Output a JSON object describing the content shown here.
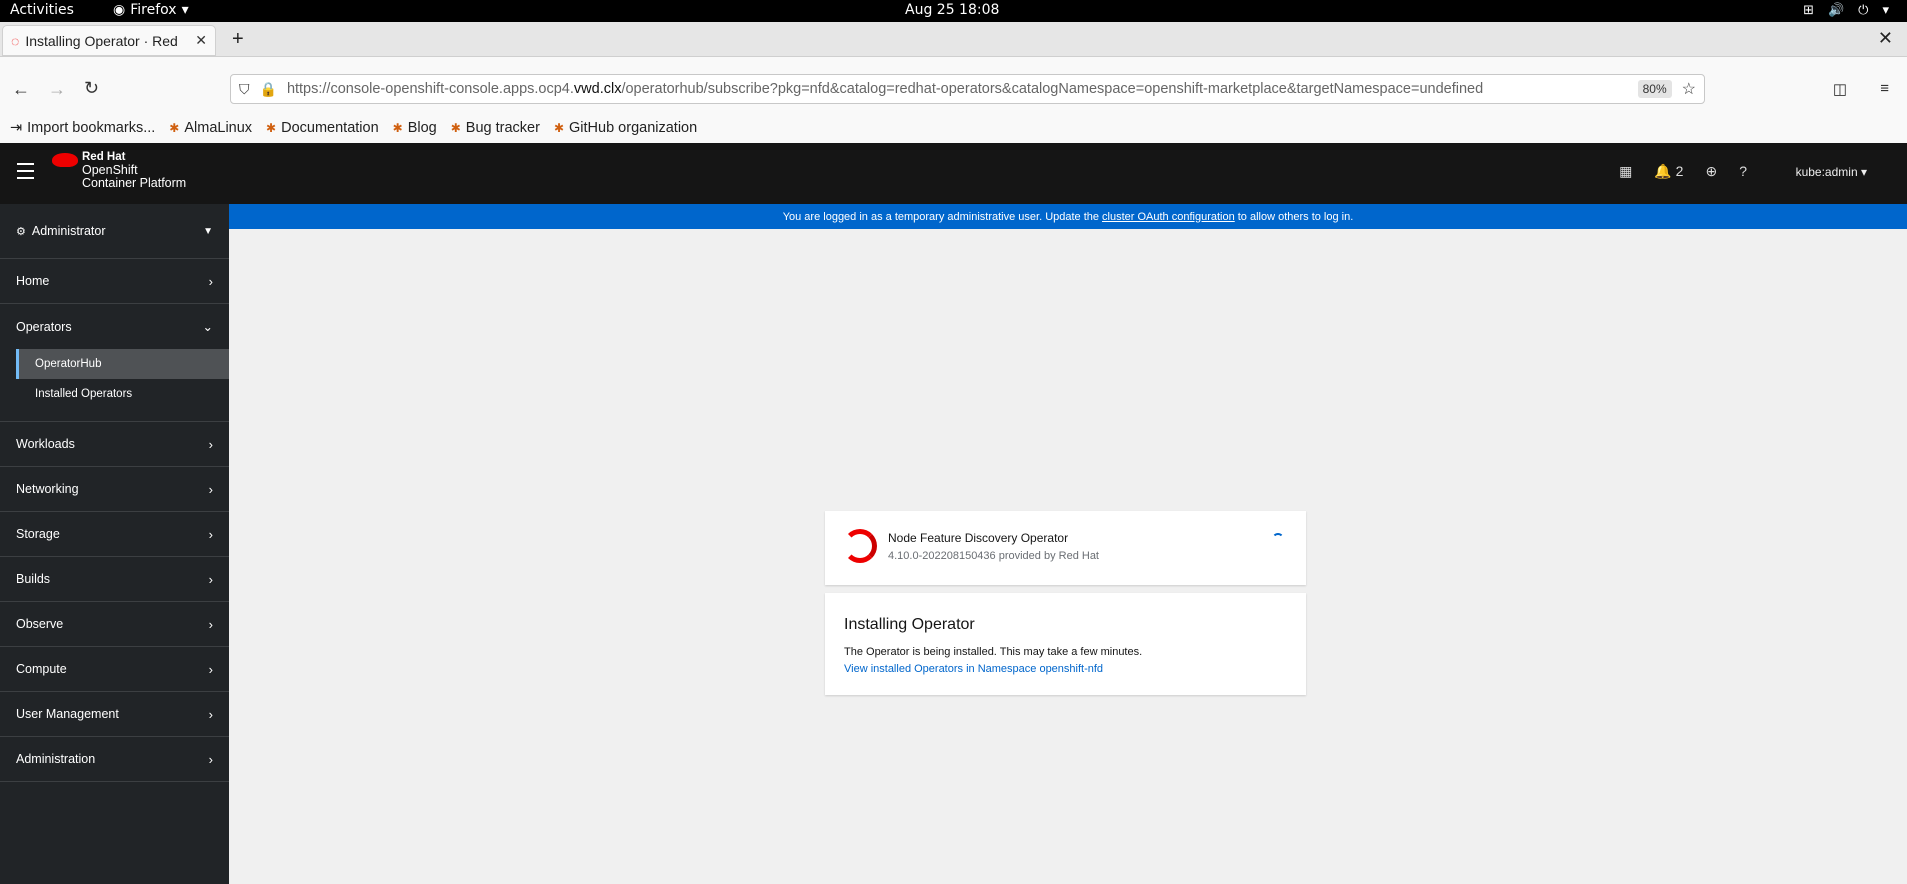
{
  "system": {
    "activities": "Activities",
    "app_name": "Firefox",
    "clock": "Aug 25  18:08"
  },
  "browser": {
    "tab_title": "Installing Operator · Red",
    "url_prefix": "https://console-openshift-console.apps.ocp4.",
    "url_domain": "vwd.clx",
    "url_suffix": "/operatorhub/subscribe?pkg=nfd&catalog=redhat-operators&catalogNamespace=openshift-marketplace&targetNamespace=undefined",
    "zoom": "80%",
    "bookmarks": [
      "Import bookmarks...",
      "AlmaLinux",
      "Documentation",
      "Blog",
      "Bug tracker",
      "GitHub organization"
    ]
  },
  "masthead": {
    "brand_line1": "Red Hat",
    "brand_line2": "OpenShift",
    "brand_line3": "Container Platform",
    "notifications_count": "2",
    "user": "kube:admin"
  },
  "sidebar": {
    "perspective": "Administrator",
    "items": [
      "Home",
      "Operators",
      "Workloads",
      "Networking",
      "Storage",
      "Builds",
      "Observe",
      "Compute",
      "User Management",
      "Administration"
    ],
    "operators_sub": [
      "OperatorHub",
      "Installed Operators"
    ]
  },
  "banner": {
    "text_before": "You are logged in as a temporary administrative user. Update the",
    "link": "cluster OAuth configuration",
    "text_after": "to allow others to log in."
  },
  "operator": {
    "name": "Node Feature Discovery Operator",
    "version_line": "4.10.0-202208150436 provided by Red Hat"
  },
  "install": {
    "title": "Installing Operator",
    "text": "The Operator is being installed. This may take a few minutes.",
    "link": "View installed Operators in Namespace openshift-nfd"
  }
}
